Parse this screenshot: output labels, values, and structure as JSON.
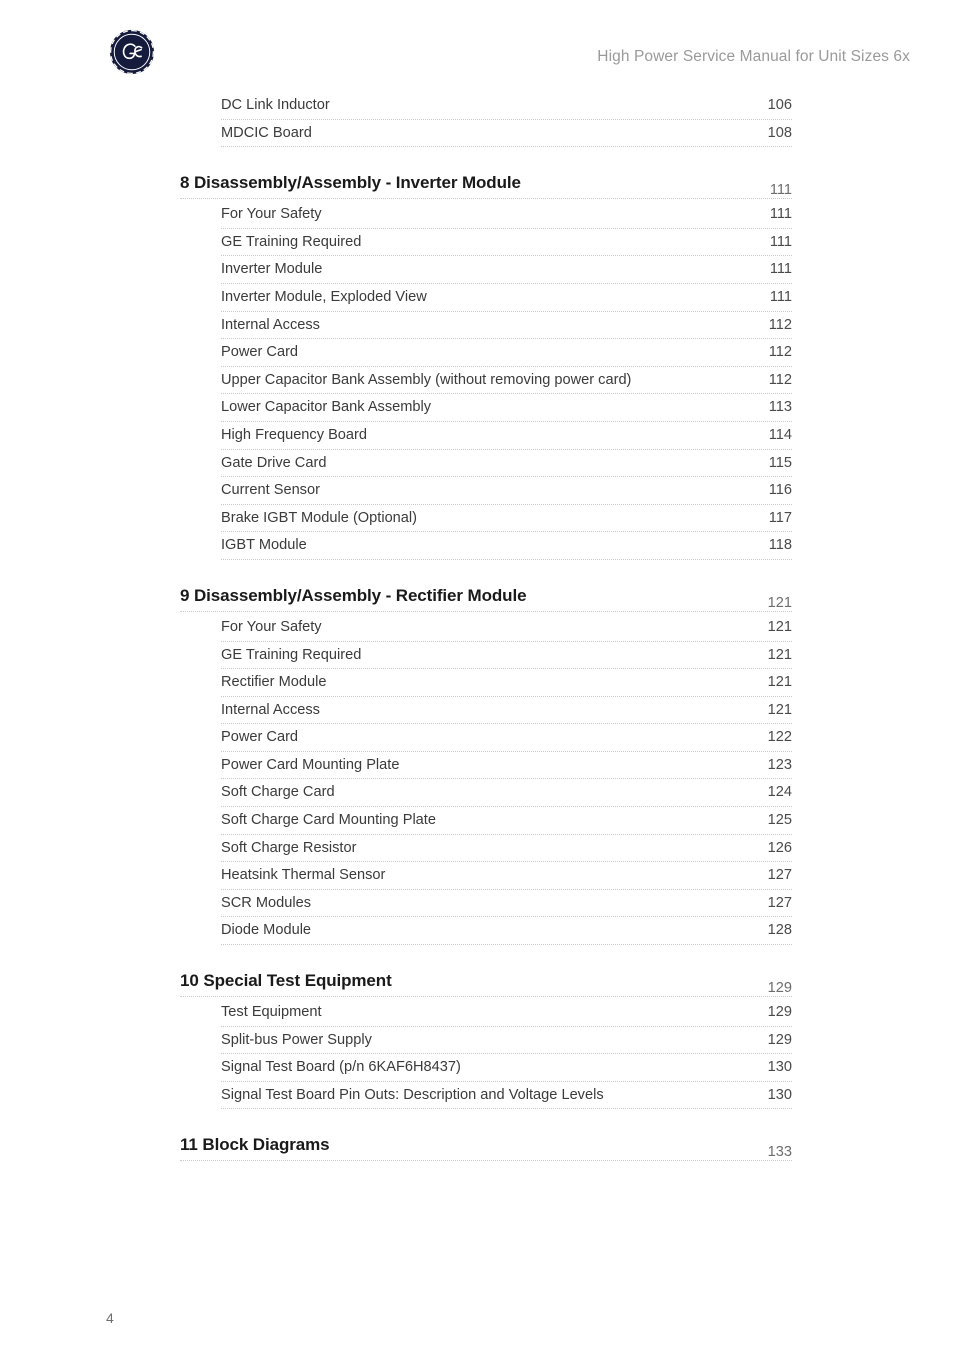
{
  "header": {
    "logo_name": "ge-monogram-logo",
    "logo_color": "#141b3d",
    "doc_title": "High Power Service Manual for Unit Sizes 6x",
    "title_color": "#9a9a9a"
  },
  "footer": {
    "page_number": "4"
  },
  "toc": {
    "entries": [
      {
        "level": 2,
        "label": "DC Link Inductor",
        "page": "106"
      },
      {
        "level": 2,
        "label": "MDCIC Board",
        "page": "108"
      },
      {
        "level": 1,
        "label": "8 Disassembly/Assembly - Inverter Module",
        "page": "111"
      },
      {
        "level": 2,
        "label": "For Your Safety",
        "page": "111"
      },
      {
        "level": 2,
        "label": "GE Training Required",
        "page": "111"
      },
      {
        "level": 2,
        "label": "Inverter Module",
        "page": "111"
      },
      {
        "level": 2,
        "label": "Inverter Module, Exploded View",
        "page": "111"
      },
      {
        "level": 2,
        "label": "Internal Access",
        "page": "112"
      },
      {
        "level": 2,
        "label": "Power Card",
        "page": "112"
      },
      {
        "level": 2,
        "label": "Upper Capacitor Bank Assembly (without removing power card)",
        "page": "112"
      },
      {
        "level": 2,
        "label": "Lower Capacitor Bank Assembly",
        "page": "113"
      },
      {
        "level": 2,
        "label": "High Frequency Board",
        "page": "114"
      },
      {
        "level": 2,
        "label": "Gate Drive Card",
        "page": "115"
      },
      {
        "level": 2,
        "label": "Current Sensor",
        "page": "116"
      },
      {
        "level": 2,
        "label": "Brake IGBT Module (Optional)",
        "page": "117"
      },
      {
        "level": 2,
        "label": "IGBT Module",
        "page": "118"
      },
      {
        "level": 1,
        "label": "9 Disassembly/Assembly - Rectifier Module",
        "page": "121"
      },
      {
        "level": 2,
        "label": "For Your Safety",
        "page": "121"
      },
      {
        "level": 2,
        "label": "GE Training Required",
        "page": "121"
      },
      {
        "level": 2,
        "label": "Rectifier Module",
        "page": "121"
      },
      {
        "level": 2,
        "label": "Internal Access",
        "page": "121"
      },
      {
        "level": 2,
        "label": "Power Card",
        "page": "122"
      },
      {
        "level": 2,
        "label": "Power Card Mounting Plate",
        "page": "123"
      },
      {
        "level": 2,
        "label": "Soft Charge Card",
        "page": "124"
      },
      {
        "level": 2,
        "label": "Soft Charge Card Mounting Plate",
        "page": "125"
      },
      {
        "level": 2,
        "label": "Soft Charge Resistor",
        "page": "126"
      },
      {
        "level": 2,
        "label": "Heatsink Thermal Sensor",
        "page": "127"
      },
      {
        "level": 2,
        "label": "SCR Modules",
        "page": "127"
      },
      {
        "level": 2,
        "label": "Diode Module",
        "page": "128"
      },
      {
        "level": 1,
        "label": "10 Special Test Equipment",
        "page": "129"
      },
      {
        "level": 2,
        "label": "Test Equipment",
        "page": "129"
      },
      {
        "level": 2,
        "label": "Split-bus Power Supply",
        "page": "129"
      },
      {
        "level": 2,
        "label": "Signal Test Board (p/n 6KAF6H8437)",
        "page": "130"
      },
      {
        "level": 2,
        "label": "Signal Test Board Pin Outs: Description and Voltage Levels",
        "page": "130"
      },
      {
        "level": 1,
        "label": "11 Block Diagrams",
        "page": "133"
      }
    ]
  }
}
